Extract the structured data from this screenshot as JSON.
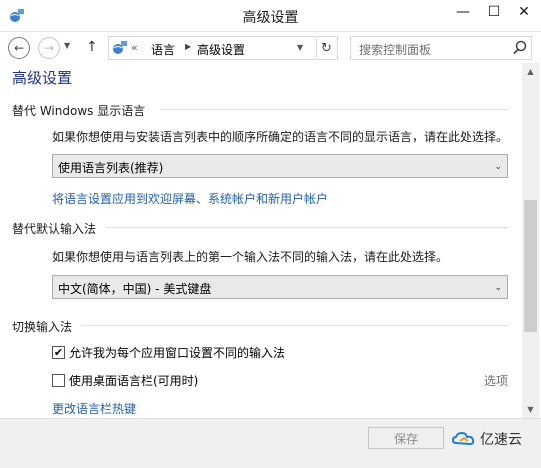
{
  "window": {
    "title": "高级设置",
    "min_glyph": "—",
    "max_glyph": "☐",
    "close_glyph": "✕"
  },
  "nav": {
    "back_glyph": "←",
    "forward_glyph": "→",
    "up_glyph": "↑",
    "dropdown_glyph": "▼",
    "breadcrumb_chevron": "«",
    "breadcrumbs": [
      "语言",
      "高级设置"
    ],
    "breadcrumb_sep": "▶",
    "address_dropdown_glyph": "▼",
    "refresh_glyph": "↻"
  },
  "search": {
    "placeholder": "搜索控制面板"
  },
  "main": {
    "page_title": "高级设置",
    "display_language": {
      "heading": "替代 Windows 显示语言",
      "description": "如果你想使用与安装语言列表中的顺序所确定的语言不同的显示语言，请在此处选择。",
      "selected": "使用语言列表(推荐)",
      "link": "将语言设置应用到欢迎屏幕、系统帐户和新用户帐户"
    },
    "input_method": {
      "heading": "替代默认输入法",
      "description": "如果你想使用与语言列表上的第一个输入法不同的输入法，请在此处选择。",
      "selected": "中文(简体，中国) - 美式键盘"
    },
    "switch_input": {
      "heading": "切换输入法",
      "checkbox1_label": "允许我为每个应用窗口设置不同的输入法",
      "checkbox1_checked": true,
      "checkbox1_glyph": "✔",
      "checkbox2_label": "使用桌面语言栏(可用时)",
      "checkbox2_checked": false,
      "options_link": "选项",
      "hotkey_link": "更改语言栏热键"
    }
  },
  "scrollbar": {
    "up_glyph": "▲",
    "down_glyph": "▼"
  },
  "footer": {
    "save_label": "保存",
    "watermark_text": "亿速云"
  },
  "select_arrow_glyph": "⌄"
}
